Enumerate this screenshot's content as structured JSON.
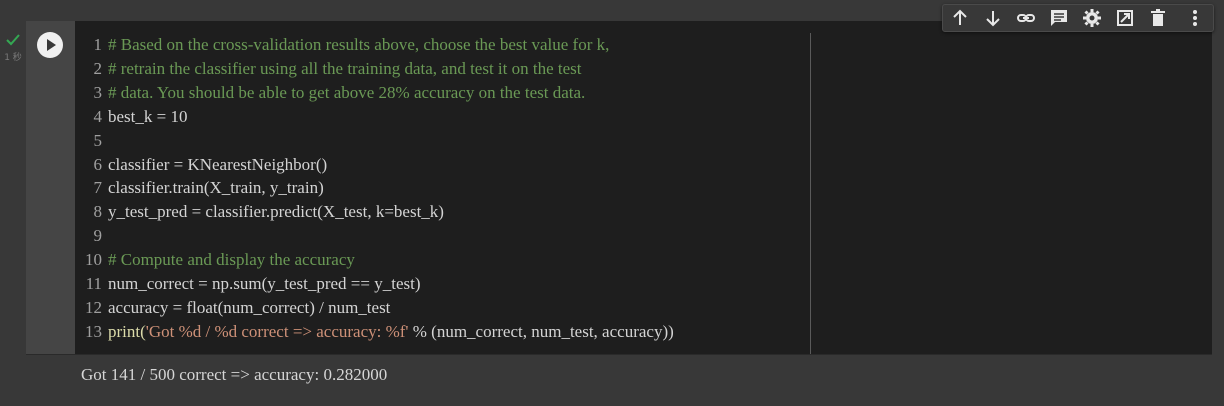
{
  "cell": {
    "exec_time": "1 秒",
    "status_icon": "checkmark-icon",
    "run_icon": "play-icon",
    "code_lines": [
      {
        "no": "1",
        "kind": "comment",
        "text": "# Based on the cross-validation results above, choose the best value for k,"
      },
      {
        "no": "2",
        "kind": "comment",
        "text": "# retrain the classifier using all the training data, and test it on the test"
      },
      {
        "no": "3",
        "kind": "comment",
        "text": "# data. You should be able to get above 28% accuracy on the test data."
      },
      {
        "no": "4",
        "kind": "code",
        "text": "best_k = 10"
      },
      {
        "no": "5",
        "kind": "code",
        "text": ""
      },
      {
        "no": "6",
        "kind": "code",
        "text": "classifier = KNearestNeighbor()"
      },
      {
        "no": "7",
        "kind": "code",
        "text": "classifier.train(X_train, y_train)"
      },
      {
        "no": "8",
        "kind": "code",
        "text": "y_test_pred = classifier.predict(X_test, k=best_k)"
      },
      {
        "no": "9",
        "kind": "code",
        "text": ""
      },
      {
        "no": "10",
        "kind": "comment",
        "text": "# Compute and display the accuracy"
      },
      {
        "no": "11",
        "kind": "code",
        "text": "num_correct = np.sum(y_test_pred == y_test)"
      },
      {
        "no": "12",
        "kind": "code",
        "text": "accuracy = float(num_correct) / num_test"
      },
      {
        "no": "13",
        "kind": "code",
        "text": "print('Got %d / %d correct => accuracy: %f' % (num_correct, num_test, accuracy))"
      }
    ],
    "line13": {
      "print_kw": "print(",
      "string": "'Got %d / %d correct => accuracy: %f'",
      "rest": " % (num_correct, num_test, accuracy))"
    },
    "output": "Got 141 / 500 correct => accuracy: 0.282000"
  },
  "toolbar": {
    "buttons": [
      {
        "name": "move-up-icon"
      },
      {
        "name": "move-down-icon"
      },
      {
        "name": "link-icon"
      },
      {
        "name": "comment-icon"
      },
      {
        "name": "settings-icon"
      },
      {
        "name": "mirror-cell-icon"
      },
      {
        "name": "delete-icon"
      },
      {
        "name": "more-vert-icon"
      }
    ]
  },
  "colors": {
    "background": "#383838",
    "editor": "#1e1e1e",
    "comment": "#6a9955",
    "string": "#ce9178",
    "check": "#34a853"
  }
}
